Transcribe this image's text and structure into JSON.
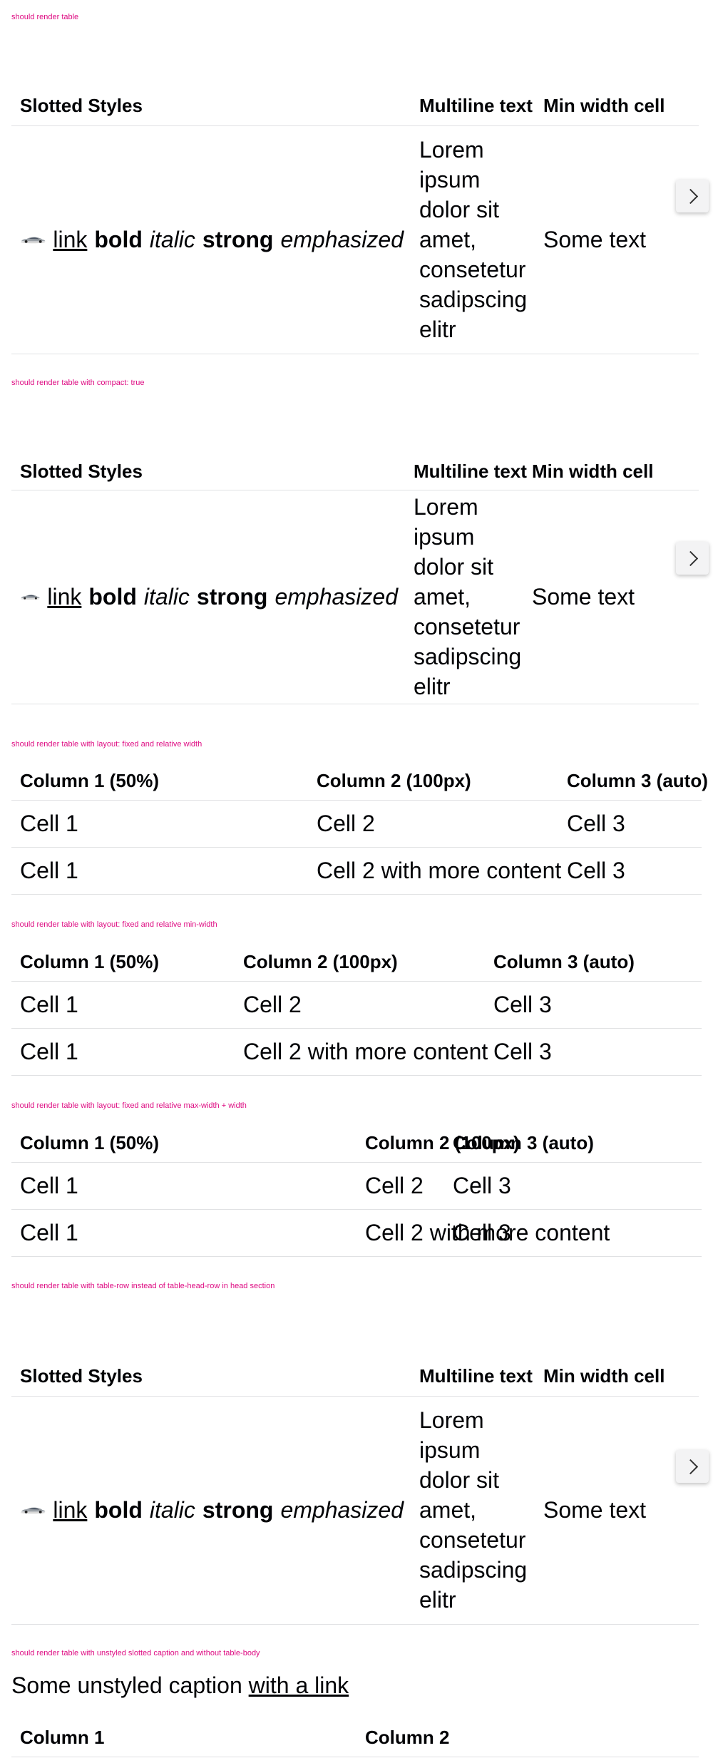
{
  "labels": {
    "s1": "should render table",
    "s2": "should render table with compact: true",
    "s3": "should render table with layout: fixed and relative width",
    "s4": "should render table with layout: fixed and relative min-width",
    "s5": "should render table with layout: fixed and relative max-width + width",
    "s6": "should render table with table-row instead of table-head-row in head section",
    "s7": "should render table with unstyled slotted caption and without table-body"
  },
  "styled_table": {
    "headers": [
      "Slotted Styles",
      "Multiline text",
      "Min width cell"
    ],
    "cell_link": "link",
    "cell_bold": "bold",
    "cell_italic": "italic",
    "cell_strong": "strong",
    "cell_em": "emphasized",
    "multiline": "Lorem ipsum dolor sit amet, consetetur sadipscing elitr",
    "min_width": "Some text"
  },
  "column_table": {
    "headers": [
      "Column 1 (50%)",
      "Column 2 (100px)",
      "Column 3 (auto)"
    ],
    "rows": [
      [
        "Cell 1",
        "Cell 2",
        "Cell 3"
      ],
      [
        "Cell 1",
        "Cell 2 with more content",
        "Cell 3"
      ]
    ]
  },
  "caption_table": {
    "caption_text": "Some unstyled caption",
    "caption_link": "with a link",
    "headers": [
      "Column 1",
      "Column 2"
    ]
  },
  "icons": {
    "scroll": "chevron-right-icon",
    "car": "car-image"
  },
  "colors": {
    "label": "#de0b82",
    "divider": "#e0e1e3",
    "text": "#010205"
  }
}
